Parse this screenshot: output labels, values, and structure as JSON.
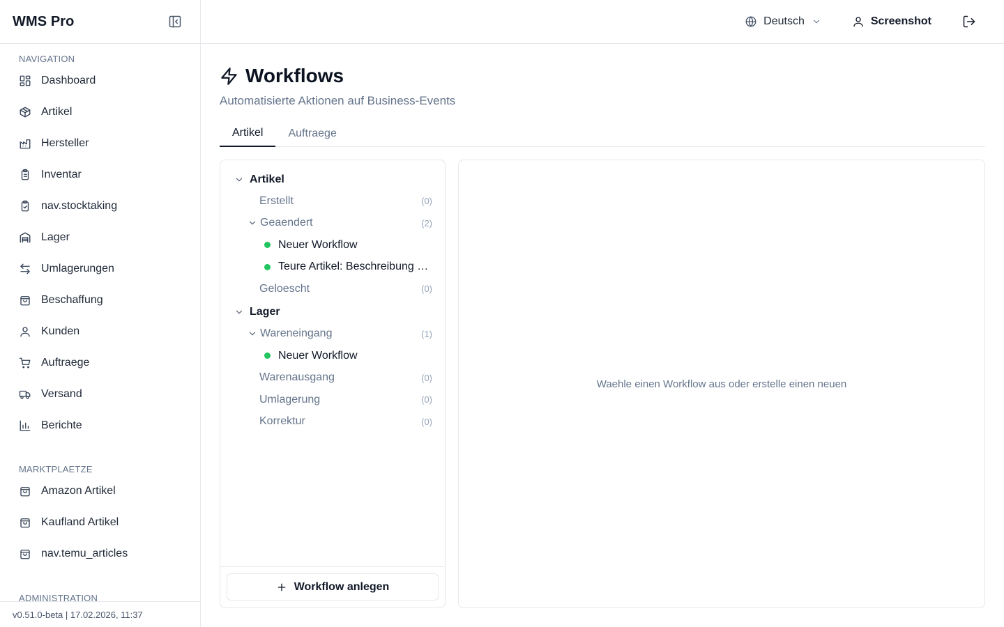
{
  "app": {
    "brand": "WMS Pro"
  },
  "sidebar": {
    "sections": [
      {
        "title": "NAVIGATION",
        "items": [
          {
            "label": "Dashboard",
            "icon": "dashboard-icon"
          },
          {
            "label": "Artikel",
            "icon": "package-icon"
          },
          {
            "label": "Hersteller",
            "icon": "factory-icon"
          },
          {
            "label": "Inventar",
            "icon": "clipboard-list-icon"
          },
          {
            "label": "nav.stocktaking",
            "icon": "clipboard-check-icon"
          },
          {
            "label": "Lager",
            "icon": "warehouse-icon"
          },
          {
            "label": "Umlagerungen",
            "icon": "arrows-left-right-icon"
          },
          {
            "label": "Beschaffung",
            "icon": "shopping-bag-icon"
          },
          {
            "label": "Kunden",
            "icon": "user-icon"
          },
          {
            "label": "Auftraege",
            "icon": "shopping-cart-icon"
          },
          {
            "label": "Versand",
            "icon": "truck-icon"
          },
          {
            "label": "Berichte",
            "icon": "bar-chart-icon"
          }
        ]
      },
      {
        "title": "MARKTPLAETZE",
        "items": [
          {
            "label": "Amazon Artikel",
            "icon": "shopping-bag-icon"
          },
          {
            "label": "Kaufland Artikel",
            "icon": "shopping-bag-icon"
          },
          {
            "label": "nav.temu_articles",
            "icon": "shopping-bag-icon"
          }
        ]
      },
      {
        "title": "ADMINISTRATION",
        "items": []
      }
    ],
    "footer": "v0.51.0-beta | 17.02.2026, 11:37"
  },
  "topbar": {
    "language": "Deutsch",
    "user": "Screenshot"
  },
  "page": {
    "title": "Workflows",
    "subtitle": "Automatisierte Aktionen auf Business-Events",
    "tabs": [
      {
        "label": "Artikel",
        "active": true
      },
      {
        "label": "Auftraege",
        "active": false
      }
    ]
  },
  "tree": {
    "groups": [
      {
        "label": "Artikel",
        "events": [
          {
            "label": "Erstellt",
            "count": "(0)",
            "expanded": false,
            "workflows": []
          },
          {
            "label": "Geaendert",
            "count": "(2)",
            "expanded": true,
            "workflows": [
              {
                "label": "Neuer Workflow",
                "status_color": "#22c55e"
              },
              {
                "label": "Teure Artikel: Beschreibung ae...",
                "status_color": "#22c55e"
              }
            ]
          },
          {
            "label": "Geloescht",
            "count": "(0)",
            "expanded": false,
            "workflows": []
          }
        ]
      },
      {
        "label": "Lager",
        "events": [
          {
            "label": "Wareneingang",
            "count": "(1)",
            "expanded": true,
            "workflows": [
              {
                "label": "Neuer Workflow",
                "status_color": "#22c55e"
              }
            ]
          },
          {
            "label": "Warenausgang",
            "count": "(0)",
            "expanded": false,
            "workflows": []
          },
          {
            "label": "Umlagerung",
            "count": "(0)",
            "expanded": false,
            "workflows": []
          },
          {
            "label": "Korrektur",
            "count": "(0)",
            "expanded": false,
            "workflows": []
          }
        ]
      }
    ],
    "add_button": "Workflow anlegen"
  },
  "detail": {
    "empty_message": "Waehle einen Workflow aus oder erstelle einen neuen"
  }
}
